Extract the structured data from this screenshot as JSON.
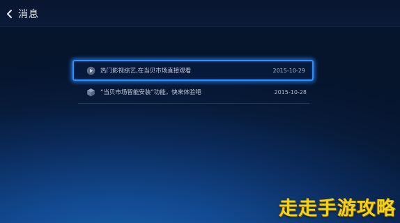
{
  "header": {
    "back_icon": "chevron-left-icon",
    "title": "消息"
  },
  "messages": [
    {
      "icon": "play-circle-icon",
      "text": "热门影视综艺,在当贝市场直接观看",
      "date": "2015-10-29",
      "selected": true
    },
    {
      "icon": "cube-icon",
      "text": "“当贝市场智能安装”功能，快来体验吧",
      "date": "2015-10-28",
      "selected": false
    }
  ],
  "watermark": {
    "text": "走走手游攻略"
  },
  "colors": {
    "focus_border": "#2f8dff",
    "watermark": "#f3d21a",
    "background_dark": "#06142c",
    "background_glow": "#1b64b4"
  }
}
